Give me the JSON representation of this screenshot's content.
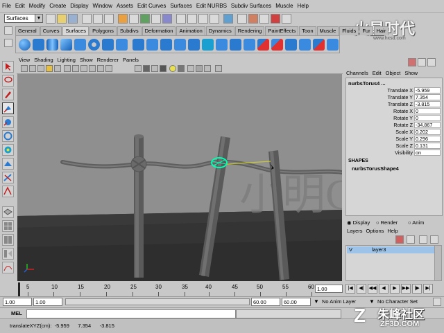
{
  "menu": [
    "File",
    "Edit",
    "Modify",
    "Create",
    "Display",
    "Window",
    "Assets",
    "Edit Curves",
    "Surfaces",
    "Edit NURBS",
    "Subdiv Surfaces",
    "Muscle",
    "Help"
  ],
  "menu_set": "Surfaces",
  "shelf_tabs": [
    "General",
    "Curves",
    "Surfaces",
    "Polygons",
    "Subdivs",
    "Deformation",
    "Animation",
    "Dynamics",
    "Rendering",
    "PaintEffects",
    "Toon",
    "Muscle",
    "Fluids",
    "Fur",
    "Hair"
  ],
  "active_shelf_tab": "Surfaces",
  "viewport_menu": [
    "View",
    "Shading",
    "Lighting",
    "Show",
    "Renderer",
    "Panels"
  ],
  "channel_box": {
    "menu": [
      "Channels",
      "Edit",
      "Object",
      "Show"
    ],
    "object": "nurbsTorus4 ...",
    "channels": [
      {
        "label": "Translate X",
        "value": "-5.959"
      },
      {
        "label": "Translate Y",
        "value": "7.354"
      },
      {
        "label": "Translate Z",
        "value": "-3.815"
      },
      {
        "label": "Rotate X",
        "value": "0"
      },
      {
        "label": "Rotate Y",
        "value": "0"
      },
      {
        "label": "Rotate Z",
        "value": "-34.867"
      },
      {
        "label": "Scale X",
        "value": "0.202"
      },
      {
        "label": "Scale Y",
        "value": "0.296"
      },
      {
        "label": "Scale Z",
        "value": "0.131"
      },
      {
        "label": "Visibility",
        "value": "on"
      }
    ],
    "shapes_header": "SHAPES",
    "shape": "nurbsTorusShape4"
  },
  "layer_editor": {
    "modes": [
      "Display",
      "Render",
      "Anim"
    ],
    "menu": [
      "Layers",
      "Options",
      "Help"
    ],
    "layer": {
      "v": "V",
      "name": "layer3"
    }
  },
  "timeline": {
    "ticks": [
      "5",
      "10",
      "15",
      "20",
      "25",
      "30",
      "35",
      "40",
      "45",
      "50",
      "55",
      "60"
    ],
    "current_frame": "1.00"
  },
  "range": {
    "start": "1.00",
    "start2": "1.00",
    "end": "60.00",
    "end2": "60.00",
    "anim_layer": "No Anim Layer",
    "character": "No Character Set"
  },
  "command": {
    "label": "MEL"
  },
  "help_line": {
    "text": "translateXYZ(cm):  -5.959      7.354      -3.815"
  },
  "watermarks": {
    "center": "小明CG",
    "top_right": "火星时代",
    "top_right_sub": "www.hxsd.com",
    "bottom_right": "朱峰社区",
    "bottom_right_sub": "ZF3D.COM"
  },
  "colors": {
    "viewport_bg": "#8f8f8f",
    "selection": "#00ffb0",
    "layer_row": "#9dc4e8"
  }
}
